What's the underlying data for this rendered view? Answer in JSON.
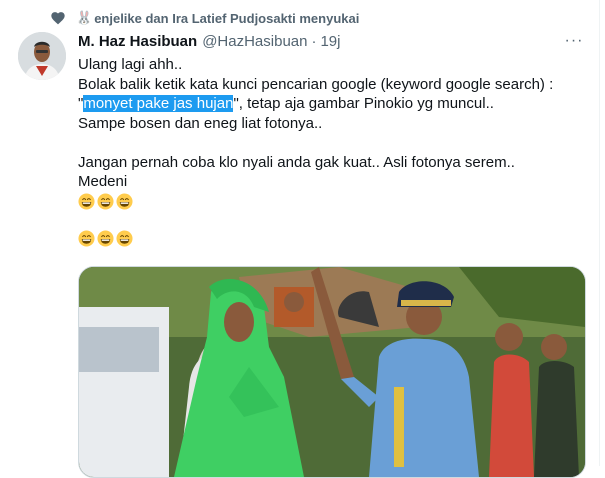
{
  "social_context": {
    "emoji": "🐰",
    "text": "enjelike dan Ira Latief Pudjosakti menyukai"
  },
  "tweet": {
    "name": "M. Haz Hasibuan",
    "handle": "@HazHasibuan",
    "separator": "·",
    "time": "19j",
    "more_label": "···",
    "lines": {
      "l1": "Ulang lagi ahh..",
      "l2": "Bolak balik ketik kata kunci pencarian google (keyword google search) :",
      "l3_open": "\"",
      "l3_highlight": "monyet pake jas hujan",
      "l3_rest": "\", tetap aja gambar Pinokio yg muncul..",
      "l4": "Sampe bosen dan eneg liat fotonya..",
      "l5": "Jangan pernah coba klo nyali anda gak kuat.. Asli fotonya serem..",
      "l6": "Medeni"
    },
    "emoji_rows": [
      3,
      3
    ]
  },
  "icons": {
    "like": "heart-icon",
    "more": "more-icon",
    "emoji": "grinning-face-emoji"
  },
  "colors": {
    "accent": "#1d9bf0",
    "secondary_text": "#536471",
    "raincoat": "#3fcf63",
    "uniform": "#6a9fd6"
  }
}
